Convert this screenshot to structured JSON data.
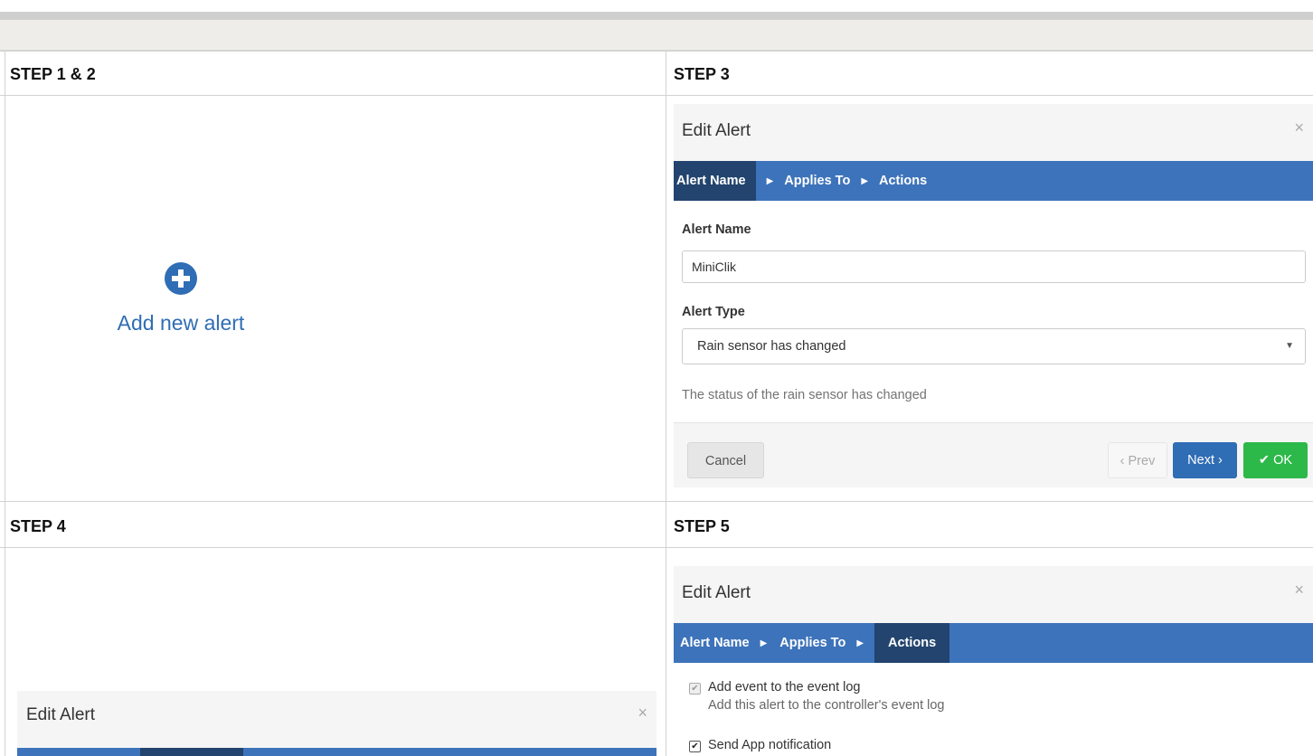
{
  "steps": {
    "s12": "STEP 1 & 2",
    "s3": "STEP 3",
    "s4": "STEP 4",
    "s5": "STEP 5"
  },
  "add_alert": {
    "label": "Add new alert",
    "icon": "plus-circle-icon"
  },
  "step3_modal": {
    "title": "Edit Alert",
    "close": "×",
    "wizard": {
      "items": [
        "Alert Name",
        "Applies To",
        "Actions"
      ],
      "active": "Alert Name",
      "separator_icon": "caret-right-icon"
    },
    "alert_name_label": "Alert Name",
    "alert_name_value": "MiniClik",
    "alert_type_label": "Alert Type",
    "alert_type_value": "Rain sensor has changed",
    "description": "The status of the rain sensor has changed",
    "buttons": {
      "cancel": "Cancel",
      "prev": "‹ Prev",
      "next": "Next ›",
      "ok": "OK"
    }
  },
  "step4_modal": {
    "title": "Edit Alert",
    "close": "×"
  },
  "step5_modal": {
    "title": "Edit Alert",
    "close": "×",
    "wizard": {
      "items": [
        "Alert Name",
        "Applies To",
        "Actions"
      ],
      "active": "Actions"
    },
    "actions": [
      {
        "label": "Add event to the event log",
        "sub": "Add this alert to the controller's event log",
        "checked": true,
        "disabled": true
      },
      {
        "label": "Send App notification",
        "checked": true,
        "disabled": false
      }
    ]
  },
  "colors": {
    "primary": "#2f6db5",
    "wizard_bar": "#3d73ba",
    "wizard_active": "#22446e",
    "ok_green": "#2db84a",
    "grid_lines": "#d2d2d2"
  }
}
